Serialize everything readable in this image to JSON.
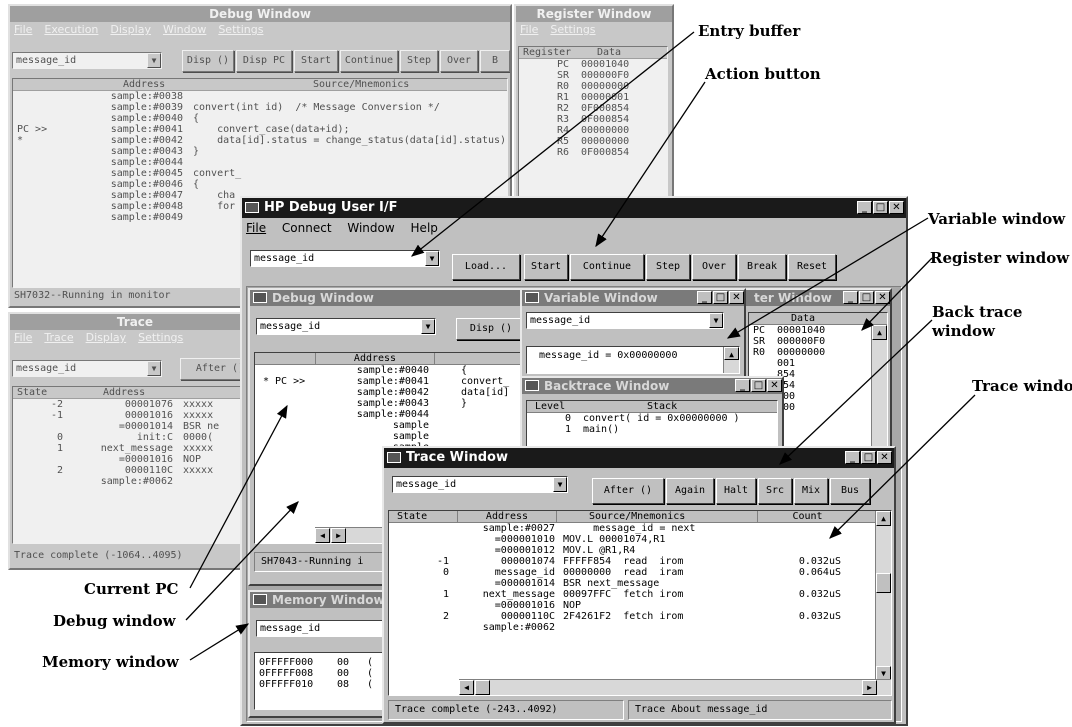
{
  "bg_debug": {
    "title": "Debug Window",
    "menu": [
      "File",
      "Execution",
      "Display",
      "Window",
      "Settings"
    ],
    "entry": "message_id",
    "buttons": [
      "Disp ()",
      "Disp PC",
      "Start",
      "Continue",
      "Step",
      "Over",
      "B"
    ],
    "col_address": "Address",
    "col_source": "Source/Mnemonics",
    "rows": [
      {
        "m": "",
        "a": "sample:#0038",
        "s": ""
      },
      {
        "m": "",
        "a": "sample:#0039",
        "s": "convert(int id)  /* Message Conversion */"
      },
      {
        "m": "",
        "a": "sample:#0040",
        "s": "{"
      },
      {
        "m": "PC >>",
        "a": "sample:#0041",
        "s": "    convert_case(data+id);"
      },
      {
        "m": "*",
        "a": "sample:#0042",
        "s": "    data[id].status = change_status(data[id].status);"
      },
      {
        "m": "",
        "a": "sample:#0043",
        "s": "}"
      },
      {
        "m": "",
        "a": "sample:#0044",
        "s": ""
      },
      {
        "m": "",
        "a": "sample:#0045",
        "s": "convert_"
      },
      {
        "m": "",
        "a": "sample:#0046",
        "s": "{"
      },
      {
        "m": "",
        "a": "sample:#0047",
        "s": "    cha"
      },
      {
        "m": "",
        "a": "sample:#0048",
        "s": "    for"
      },
      {
        "m": "",
        "a": "sample:#0049",
        "s": ""
      }
    ],
    "status": "SH7032--Running in monitor"
  },
  "bg_register": {
    "title": "Register Window",
    "menu": [
      "File",
      "Settings"
    ],
    "col_register": "Register",
    "col_data": "Data",
    "rows": [
      {
        "r": "PC",
        "d": "00001040"
      },
      {
        "r": "SR",
        "d": "000000F0"
      },
      {
        "r": "R0",
        "d": "00000000"
      },
      {
        "r": "R1",
        "d": "00000001"
      },
      {
        "r": "R2",
        "d": "0F000854"
      },
      {
        "r": "R3",
        "d": "0F000854"
      },
      {
        "r": "R4",
        "d": "00000000"
      },
      {
        "r": "R5",
        "d": "00000000"
      },
      {
        "r": "R6",
        "d": "0F000854"
      }
    ]
  },
  "bg_trace": {
    "title": "Trace",
    "menu": [
      "File",
      "Trace",
      "Display",
      "Settings"
    ],
    "entry": "message_id",
    "after_button": "After ()",
    "col_state": "State",
    "col_address": "Address",
    "rows": [
      {
        "st": "-2",
        "ad": "00001076",
        "x": "xxxxx"
      },
      {
        "st": "-1",
        "ad": "00001016",
        "x": "xxxxx"
      },
      {
        "st": "",
        "ad": "=00001014",
        "x": "BSR ne"
      },
      {
        "st": "0",
        "ad": "init:C",
        "x": "0000("
      },
      {
        "st": "1",
        "ad": "next_message",
        "x": "xxxxx"
      },
      {
        "st": "",
        "ad": "=00001016",
        "x": "NOP"
      },
      {
        "st": "2",
        "ad": "0000110C",
        "x": "xxxxx"
      },
      {
        "st": "",
        "ad": "sample:#0062",
        "x": ""
      }
    ],
    "status": "Trace complete (-1064..4095)"
  },
  "main": {
    "title": "HP Debug User I/F",
    "menu": [
      "File",
      "Connect",
      "Window",
      "Help"
    ],
    "entry": "message_id",
    "buttons": [
      "Load...",
      "Start",
      "Continue",
      "Step",
      "Over",
      "Break",
      "Reset"
    ]
  },
  "debug": {
    "title": "Debug Window",
    "entry": "message_id",
    "disp_button": "Disp ()",
    "col_address": "Address",
    "rows": [
      {
        "m": "",
        "a": "sample:#0040",
        "s": "{"
      },
      {
        "m": "* PC >>",
        "a": "sample:#0041",
        "s": "convert_"
      },
      {
        "m": "",
        "a": "sample:#0042",
        "s": "data[id]"
      },
      {
        "m": "",
        "a": "sample:#0043",
        "s": "}"
      },
      {
        "m": "",
        "a": "sample:#0044",
        "s": ""
      },
      {
        "m": "",
        "a": "sample",
        "s": ""
      },
      {
        "m": "",
        "a": "sample",
        "s": ""
      },
      {
        "m": "",
        "a": "sample",
        "s": ""
      },
      {
        "m": "",
        "a": "sample",
        "s": ""
      },
      {
        "m": "",
        "a": "sample",
        "s": ""
      },
      {
        "m": "",
        "a": "sample",
        "s": ""
      }
    ],
    "status": "SH7043--Running i"
  },
  "variable": {
    "title": "Variable Window",
    "entry": "message_id",
    "value": "message_id = 0x00000000"
  },
  "register": {
    "title": "ter Window",
    "col_data": "Data",
    "rows": [
      {
        "r": "PC",
        "d": "00001040"
      },
      {
        "r": "SR",
        "d": "000000F0"
      },
      {
        "r": "R0",
        "d": "00000000"
      },
      {
        "r": "",
        "d": "001"
      },
      {
        "r": "",
        "d": "854"
      },
      {
        "r": "",
        "d": "854"
      },
      {
        "r": "",
        "d": "000"
      },
      {
        "r": "",
        "d": "000"
      }
    ]
  },
  "backtrace": {
    "title": "Backtrace Window",
    "col_level": "Level",
    "col_stack": "Stack",
    "rows": [
      {
        "l": "0",
        "s": "convert( id = 0x00000000 )"
      },
      {
        "l": "1",
        "s": "main()"
      }
    ]
  },
  "memory": {
    "title": "Memory Window",
    "entry": "message_id",
    "rows": [
      {
        "a": "0FFFFF000",
        "b": "00",
        "c": "("
      },
      {
        "a": "0FFFFF008",
        "b": "00",
        "c": "("
      },
      {
        "a": "0FFFFF010",
        "b": "08",
        "c": "("
      }
    ]
  },
  "trace": {
    "title": "Trace Window",
    "entry": "message_id",
    "buttons": [
      "After ()",
      "Again",
      "Halt",
      "Src",
      "Mix",
      "Bus"
    ],
    "col_state": "State",
    "col_address": "Address",
    "col_source": "Source/Mnemonics",
    "col_count": "Count",
    "rows": [
      {
        "st": "",
        "ad": "sample:#0027",
        "src": "     message_id = next",
        "ct": ""
      },
      {
        "st": "",
        "ad": "=000001010",
        "src": "MOV.L 00001074,R1",
        "ct": ""
      },
      {
        "st": "",
        "ad": "=000001012",
        "src": "MOV.L @R1,R4",
        "ct": ""
      },
      {
        "st": "-1",
        "ad": "000001074",
        "src": "FFFFF854  read  irom",
        "ct": "0.032uS"
      },
      {
        "st": "0",
        "ad": "message_id",
        "src": "00000000  read  iram",
        "ct": "0.064uS"
      },
      {
        "st": "",
        "ad": "=000001014",
        "src": "BSR next_message",
        "ct": ""
      },
      {
        "st": "1",
        "ad": "next_message",
        "src": "00097FFC  fetch irom",
        "ct": "0.032uS"
      },
      {
        "st": "",
        "ad": "=000001016",
        "src": "NOP",
        "ct": ""
      },
      {
        "st": "2",
        "ad": "00000110C",
        "src": "2F4261F2  fetch irom",
        "ct": "0.032uS"
      },
      {
        "st": "",
        "ad": "sample:#0062",
        "src": "",
        "ct": ""
      }
    ],
    "status_left": "Trace complete (-243..4092)",
    "status_right": "Trace About message_id"
  },
  "callouts": {
    "entry_buffer": "Entry buffer",
    "action_button": "Action button",
    "variable_window": "Variable window",
    "register_window": "Register window",
    "back_trace_window": "Back trace\nwindow",
    "trace_window": "Trace window",
    "current_pc": "Current PC",
    "debug_window": "Debug window",
    "memory_window": "Memory window"
  }
}
